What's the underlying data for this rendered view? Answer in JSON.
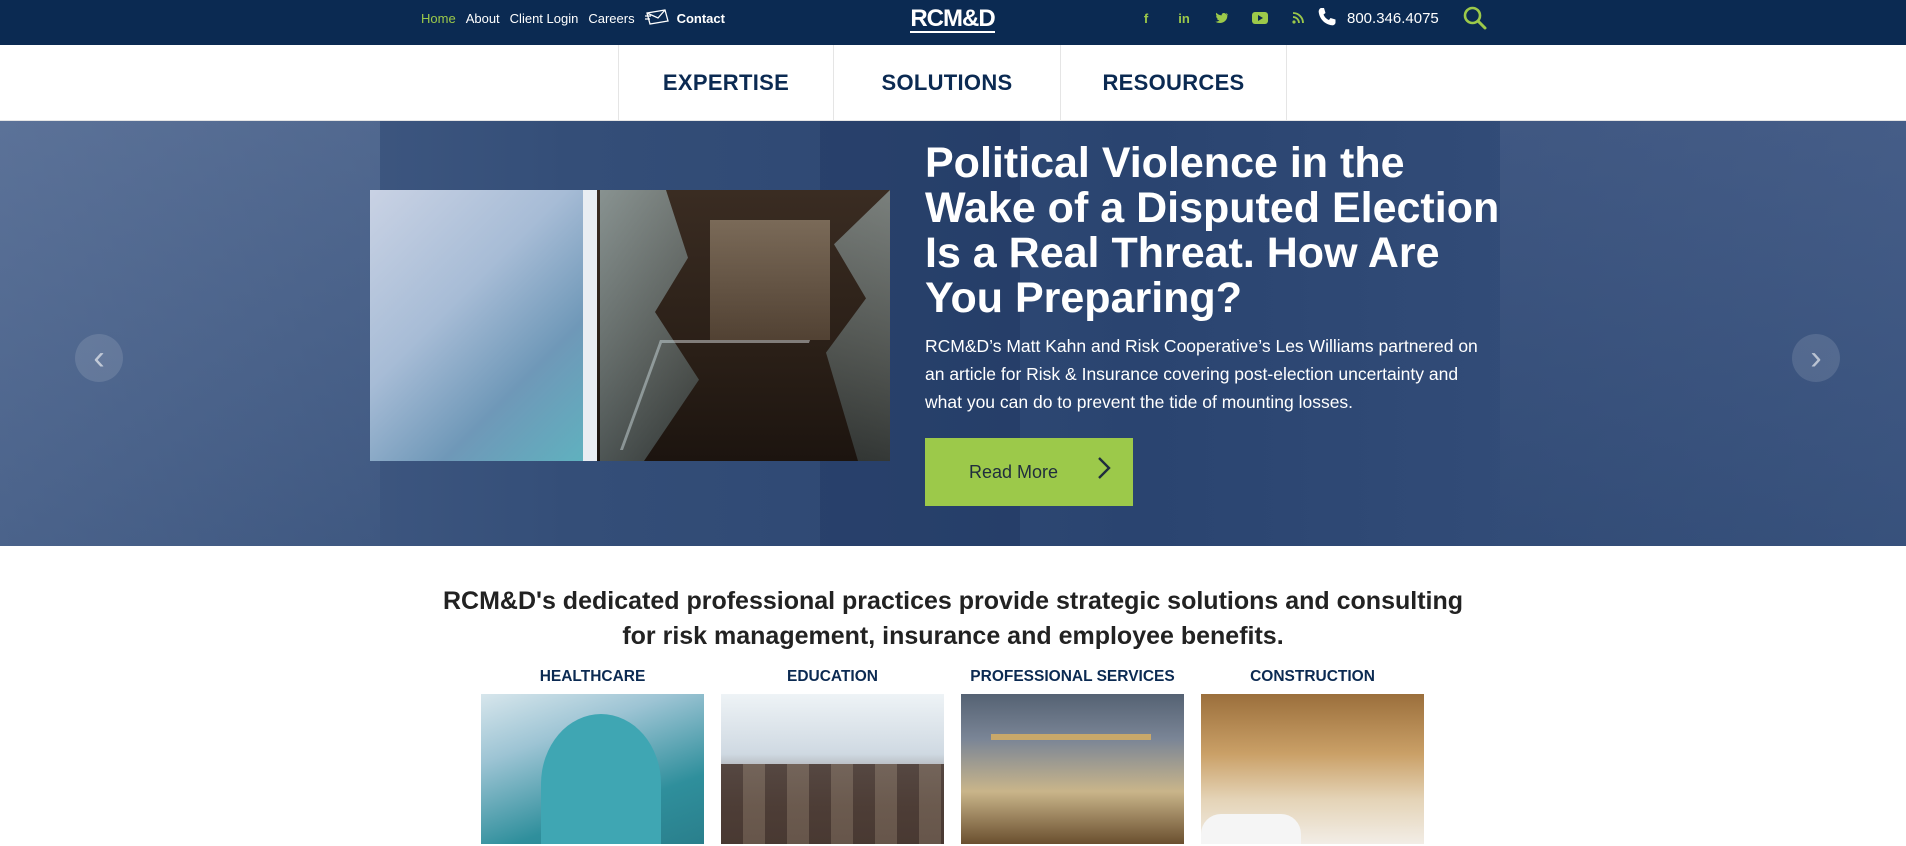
{
  "topbar": {
    "links": [
      "Home",
      "About",
      "Client Login",
      "Careers"
    ],
    "contact_label": "Contact",
    "logo_text": "RCM&D",
    "social": [
      {
        "icon": "facebook-icon",
        "glyph": "f"
      },
      {
        "icon": "linkedin-icon",
        "glyph": "in"
      },
      {
        "icon": "twitter-icon",
        "glyph": "t"
      },
      {
        "icon": "youtube-icon",
        "glyph": "▶"
      },
      {
        "icon": "rss-icon",
        "glyph": "rss"
      }
    ],
    "phone": "800.346.4075",
    "accent_color": "#9cc94a",
    "bar_color": "#0b2a52"
  },
  "nav": {
    "items": [
      "EXPERTISE",
      "SOLUTIONS",
      "RESOURCES"
    ]
  },
  "hero": {
    "title": "Political Violence in the Wake of a Disputed Election Is a Real Threat. How Are You Preparing?",
    "body": "RCM&D’s Matt Kahn and Risk Cooperative’s Les Williams partnered on an article for Risk & Insurance covering post-election uncertainty and what you can do to prevent the tide of mounting losses.",
    "button_label": "Read More",
    "prev_glyph": "‹",
    "next_glyph": "›"
  },
  "intro": {
    "text": "RCM&D's dedicated professional practices provide strategic solutions and consulting for risk management, insurance and employee benefits."
  },
  "practices": [
    {
      "title": "HEALTHCARE"
    },
    {
      "title": "EDUCATION"
    },
    {
      "title": "PROFESSIONAL SERVICES"
    },
    {
      "title": "CONSTRUCTION"
    }
  ]
}
